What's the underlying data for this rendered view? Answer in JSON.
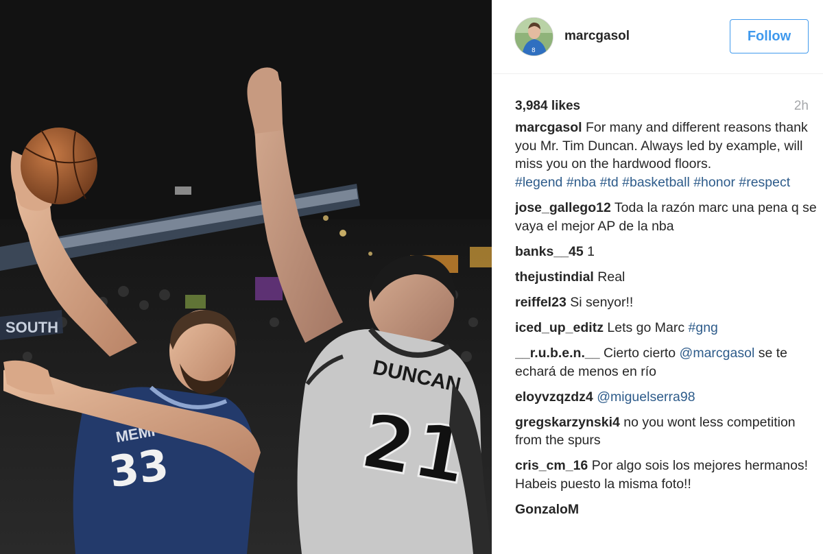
{
  "post": {
    "username": "marcgasol",
    "follow_label": "Follow",
    "likes": "3,984 likes",
    "time": "2h"
  },
  "photo": {
    "jersey_left_team": "MEMPHIS",
    "jersey_left_number": "33",
    "jersey_right_name": "DUNCAN",
    "jersey_right_number": "21",
    "banner_text": "SOUTH",
    "avatar_jersey_number": "8"
  },
  "caption": {
    "user": "marcgasol",
    "text": "For many and different reasons thank you Mr. Tim Duncan. Always led by example, will miss you on the hardwood floors.",
    "tags": "#legend #nba #td #basketball #honor #respect"
  },
  "comments": [
    {
      "user": "jose_gallego12",
      "text": "Toda la razón marc una pena q se vaya el mejor AP de la nba"
    },
    {
      "user": "banks__45",
      "text": "1"
    },
    {
      "user": "thejustindial",
      "text": "Real"
    },
    {
      "user": "reiffel23",
      "text": "Si senyor!!"
    },
    {
      "user": "iced_up_editz",
      "text": "Lets go Marc",
      "tag": "#gng"
    },
    {
      "user": "__r.u.b.e.n.__",
      "text": "Cierto cierto",
      "mention": "@marcgasol",
      "text2": "se te echará de menos en río"
    },
    {
      "user": "eloyvzqzdz4",
      "mention": "@miguelserra98"
    },
    {
      "user": "gregskarzynski4",
      "text": "no you wont less competition from the spurs"
    },
    {
      "user": "cris_cm_16",
      "text": "Por algo sois los mejores hermanos! Habeis puesto la misma foto!!"
    },
    {
      "user": "GonzaloM",
      "text": ""
    }
  ]
}
